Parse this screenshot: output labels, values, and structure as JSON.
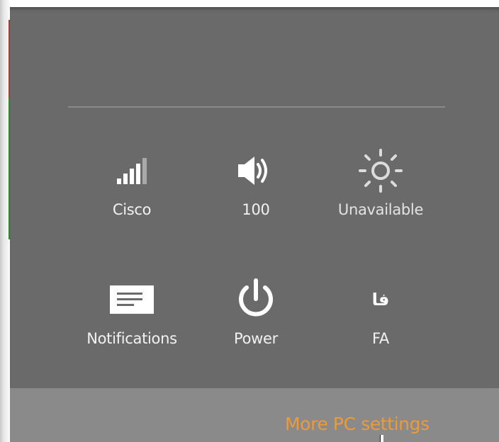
{
  "quick_settings": {
    "network": {
      "label": "Cisco",
      "icon": "wifi-signal-icon"
    },
    "volume": {
      "label": "100",
      "icon": "speaker-volume-icon"
    },
    "brightness": {
      "label": "Unavailable",
      "icon": "brightness-sun-icon"
    },
    "notifications": {
      "label": "Notifications",
      "icon": "notifications-icon"
    },
    "power": {
      "label": "Power",
      "icon": "power-icon"
    },
    "keyboard": {
      "label": "FA",
      "glyph": "فا",
      "icon": "keyboard-language-icon"
    }
  },
  "footer": {
    "more_settings_label": "More PC settings"
  },
  "colors": {
    "panel": "#6a6a6a",
    "footer": "#8a8a8a",
    "accent_link": "#ec9a3a",
    "text": "#ffffff"
  }
}
